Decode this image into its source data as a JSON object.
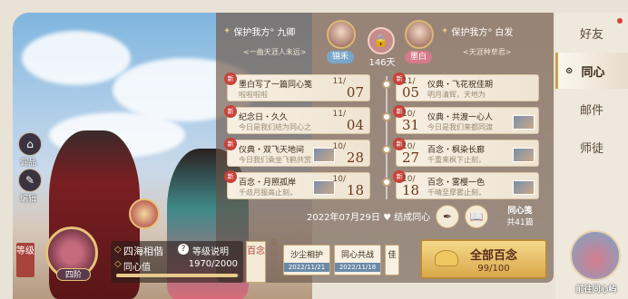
{
  "sidebar": {
    "tabs": [
      {
        "label": "好友",
        "active": false
      },
      {
        "label": "同心",
        "active": true
      },
      {
        "label": "邮件",
        "active": false
      },
      {
        "label": "师徒",
        "active": false
      }
    ]
  },
  "left_actions": [
    {
      "label": "调品",
      "icon": "pavilion-icon"
    },
    {
      "label": "编辑",
      "icon": "pen-icon"
    }
  ],
  "couple": {
    "left": {
      "title": "保护我方°",
      "name": "九卿",
      "badge": "锦禾",
      "motto": "<一曲天涯人未远>"
    },
    "right": {
      "title": "保护我方°",
      "name": "白发",
      "badge": "墨白",
      "motto": "<天涯种草君>"
    },
    "days": "146天"
  },
  "cards_left": [
    {
      "new": "新",
      "title": "墨白写了一篇同心笺",
      "sub": "啦啦啦啦",
      "month": "11/",
      "day": "07"
    },
    {
      "new": "新",
      "title": "纪念日・久久",
      "sub": "今日是我们结为同心之",
      "month": "11/",
      "day": "04"
    },
    {
      "new": "新",
      "title": "仪典・双飞天地间",
      "sub": "今日我们乘坐飞鹤共赏",
      "month": "10/",
      "day": "28"
    },
    {
      "new": "新",
      "title": "百念・月照孤岸",
      "sub": "千歧月服高止刻，",
      "month": "10/",
      "day": "18"
    }
  ],
  "cards_right": [
    {
      "new": "新",
      "title": "仪典・飞花祝佳期",
      "sub": "明月清辉，天地为",
      "month": "11/",
      "day": "05"
    },
    {
      "new": "新",
      "title": "仪典・共渡一心人",
      "sub": "今日是我们来都同渡",
      "month": "10/",
      "day": "31"
    },
    {
      "new": "新",
      "title": "百念・枫染长廊",
      "sub": "千重来枫下止刻，",
      "month": "10/",
      "day": "27"
    },
    {
      "new": "新",
      "title": "百念・雾樱一色",
      "sub": "千晴至厚雾止刻，",
      "month": "10/",
      "day": "18"
    }
  ],
  "bond_date": "2022年07月29日",
  "bond_text": "结成同心",
  "letters": {
    "label": "同心笺",
    "count": "共41篇"
  },
  "level": {
    "tag": "等级",
    "name": "四阶",
    "bond_name": "四海相偕",
    "help": "等级说明",
    "value_label": "同心值",
    "value": "1970/2000",
    "progress": 0.985
  },
  "gifts": {
    "label": "百念",
    "near": "最近达成",
    "items": [
      {
        "title": "沙尘相护",
        "date": "2022/11/21"
      },
      {
        "title": "同心共战",
        "date": "2022/11/18"
      },
      {
        "title": "佳",
        "date": ""
      }
    ]
  },
  "all_gifts": {
    "label": "全部百念",
    "count": "99/100"
  },
  "island": {
    "label": "前往同心屿"
  }
}
